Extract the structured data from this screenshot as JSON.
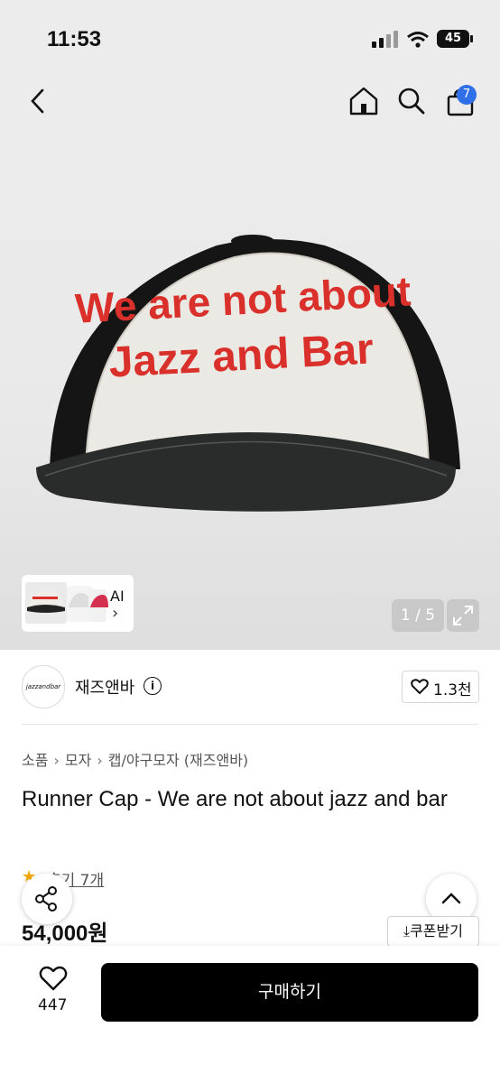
{
  "status_bar": {
    "time": "11:53",
    "battery": "45"
  },
  "nav": {
    "back_icon": "chevron-left-icon",
    "home_icon": "home-icon",
    "search_icon": "search-icon",
    "cart_icon": "shopping-bag-icon",
    "cart_count": "7"
  },
  "hero": {
    "cap_text_line1": "We are not about",
    "cap_text_line2": "Jazz and Bar",
    "ai_label": "AI",
    "ai_chevron": "›",
    "counter": "1 / 5",
    "expand_icon": "expand-icon"
  },
  "brand": {
    "logo_text": "jazzandbar",
    "name": "재즈앤바",
    "likes": "1.3천"
  },
  "breadcrumb": [
    "소품",
    "모자",
    "캡/야구모자 (재즈앤바)"
  ],
  "product": {
    "title": "Runner Cap - We are not about jazz and bar",
    "rating_star": "★",
    "reviews": "후기 7개",
    "price": "54,000원",
    "coupon": "⤓쿠폰받기"
  },
  "bottom": {
    "wish_count": "447",
    "buy_label": "구매하기"
  },
  "colors": {
    "accent_badge": "#2f6fe8",
    "cap_text": "#d9302b",
    "buy_button": "#000000"
  }
}
